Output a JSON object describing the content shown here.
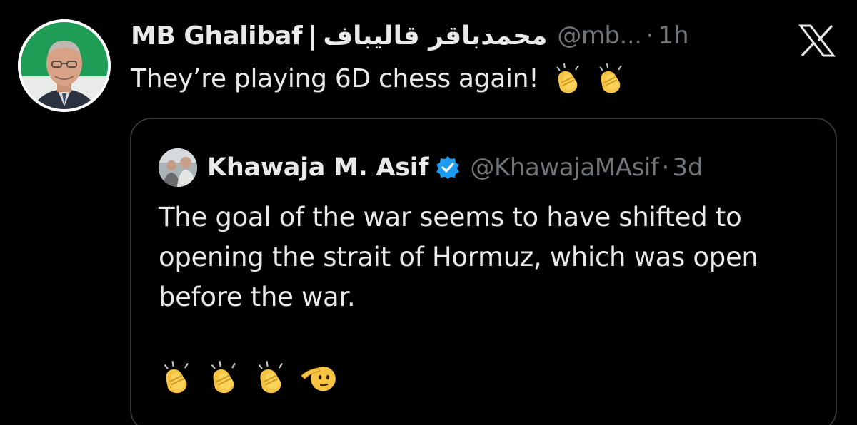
{
  "tweet": {
    "author": {
      "display_name": "MB Ghalibaf",
      "separator": "|",
      "display_name_fa": "محمدباقر قالیباف",
      "handle": "@mb...",
      "dot": "·",
      "time": "1h"
    },
    "text": "They’re playing 6D chess again!",
    "emojis": [
      "clapping-hands",
      "clapping-hands"
    ]
  },
  "quote": {
    "author": {
      "display_name": "Khawaja M. Asif",
      "verified": true,
      "handle": "@KhawajaMAsif",
      "dot": "·",
      "time": "3d"
    },
    "text": "The goal of the war seems to have shifted to opening the strait of Hormuz, which was open before the war.",
    "emojis": [
      "clapping-hands",
      "clapping-hands",
      "clapping-hands",
      "saluting-face"
    ]
  },
  "icons": {
    "brand": "x-logo-icon",
    "verified": "verified-badge-icon"
  },
  "colors": {
    "background": "#000000",
    "primary_text": "#e7e9ea",
    "secondary_text": "#71767b",
    "border": "#2f3336",
    "verified_blue": "#1d9bf0"
  }
}
